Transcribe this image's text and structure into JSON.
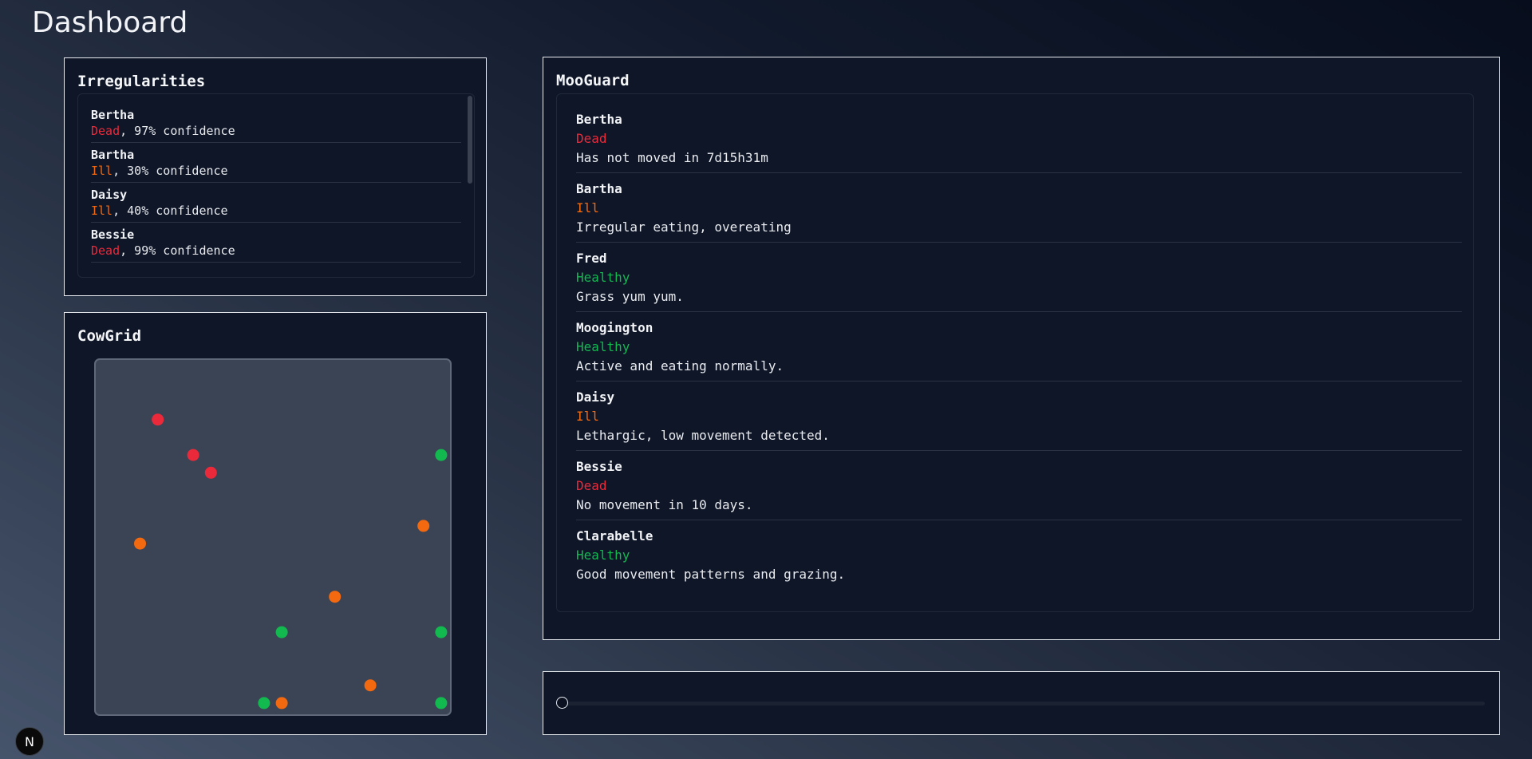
{
  "page": {
    "title": "Dashboard"
  },
  "colors": {
    "Dead": "#ea2a3a",
    "Ill": "#f2690f",
    "Healthy": "#12b94f"
  },
  "irregularities": {
    "title": "Irregularities",
    "items": [
      {
        "name": "Bertha",
        "status": "Dead",
        "confidence": ", 97% confidence"
      },
      {
        "name": "Bartha",
        "status": "Ill",
        "confidence": ", 30% confidence"
      },
      {
        "name": "Daisy",
        "status": "Ill",
        "confidence": ", 40% confidence"
      },
      {
        "name": "Bessie",
        "status": "Dead",
        "confidence": ", 99% confidence"
      }
    ]
  },
  "cowgrid": {
    "title": "CowGrid",
    "cows": [
      {
        "status": "Dead",
        "col": 3,
        "row": 3
      },
      {
        "status": "Dead",
        "col": 5,
        "row": 5
      },
      {
        "status": "Dead",
        "col": 6,
        "row": 6
      },
      {
        "status": "Ill",
        "col": 2,
        "row": 10
      },
      {
        "status": "Healthy",
        "col": 19,
        "row": 5
      },
      {
        "status": "Ill",
        "col": 18,
        "row": 9
      },
      {
        "status": "Ill",
        "col": 13,
        "row": 13
      },
      {
        "status": "Healthy",
        "col": 10,
        "row": 15
      },
      {
        "status": "Healthy",
        "col": 19,
        "row": 15
      },
      {
        "status": "Ill",
        "col": 15,
        "row": 18
      },
      {
        "status": "Healthy",
        "col": 9,
        "row": 19
      },
      {
        "status": "Ill",
        "col": 10,
        "row": 19
      },
      {
        "status": "Healthy",
        "col": 19,
        "row": 19
      }
    ]
  },
  "mooguard": {
    "title": "MooGuard",
    "items": [
      {
        "name": "Bertha",
        "status": "Dead",
        "description": "Has not moved in 7d15h31m"
      },
      {
        "name": "Bartha",
        "status": "Ill",
        "description": "Irregular eating, overeating"
      },
      {
        "name": "Fred",
        "status": "Healthy",
        "description": "Grass yum yum."
      },
      {
        "name": "Moogington",
        "status": "Healthy",
        "description": "Active and eating normally."
      },
      {
        "name": "Daisy",
        "status": "Ill",
        "description": "Lethargic, low movement detected."
      },
      {
        "name": "Bessie",
        "status": "Dead",
        "description": "No movement in 10 days."
      },
      {
        "name": "Clarabelle",
        "status": "Healthy",
        "description": "Good movement patterns and grazing."
      }
    ]
  },
  "timeline": {
    "value": 0
  },
  "badge": {
    "label": "N"
  }
}
